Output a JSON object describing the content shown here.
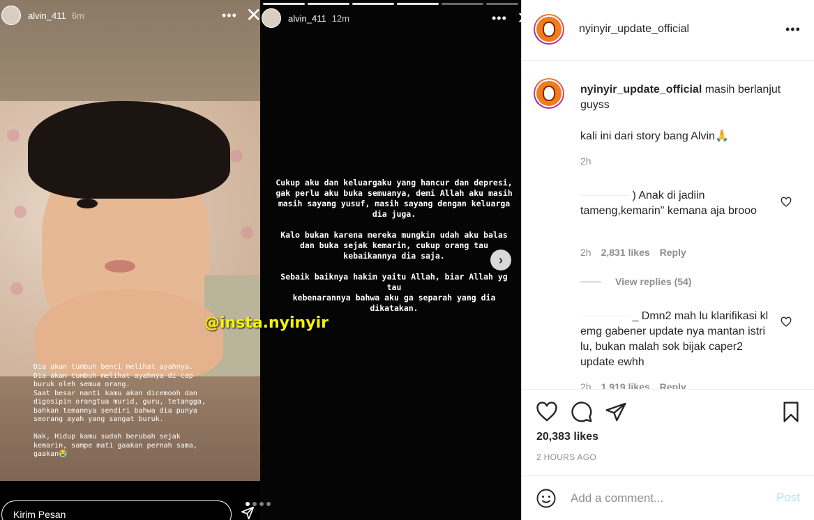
{
  "left_story": {
    "username": "alvin_411",
    "time": "6m",
    "more": "•••",
    "close": "✕",
    "watermark": "@insta.nyinyir",
    "caption": "Dia akan tumbuh benci melihat ayahnya.\nDia akan tumbuh melihat ayahnya di cap\nburuk oleh semua orang.\nSaat besar nanti kamu akan dicemooh dan\ndigosipin orangtua murid, guru, tetangga,\nbahkan temannya sendiri bahwa dia punya\nseorang ayah yang sangat buruk.\n\nNak, Hidup kamu sudah berubah sejak\nkemarin, sampe mati gaakan pernah sama,\ngaakan😭",
    "send_placeholder": "Kirim Pesan"
  },
  "mid_story": {
    "username": "alvin_411",
    "time": "12m",
    "more": "•••",
    "text": "Cukup aku dan keluargaku yang hancur dan depresi,\ngak perlu aku buka semuanya, demi Allah aku masih\nmasih sayang yusuf, masih sayang dengan keluarga\ndia juga.\n\nKalo bukan karena mereka mungkin udah aku balas\ndan buka sejak kemarin, cukup orang tau\nkebaikannya dia saja.\n\nSebaik baiknya hakim yaitu Allah, biar Allah yg tau\nkebenarannya bahwa aku ga separah yang dia\ndikatakan.",
    "next": "›"
  },
  "post": {
    "username": "nyinyir_update_official",
    "more": "•••",
    "caption_user": "nyinyir_update_official",
    "caption_text": " masih berlanjut guyss",
    "caption_extra": "kali ini dari story bang Alvin🙏",
    "caption_time": "2h",
    "comments": [
      {
        "text": ") Anak di jadiin tameng,kemarin\" kemana aja brooo",
        "time": "2h",
        "likes": "2,831 likes",
        "reply": "Reply",
        "view_replies": "View replies (54)"
      },
      {
        "text": "_ Dmn2 mah lu klarifikasi kl emg gabener update nya mantan istri lu, bukan malah sok bijak caper2 update ewhh",
        "time": "2h",
        "likes": "1,919 likes",
        "reply": "Reply"
      }
    ],
    "likes": "20,383 likes",
    "ago": "2 HOURS AGO",
    "add_comment_placeholder": "Add a comment...",
    "post_button": "Post"
  },
  "icons": {
    "heart": "heart-icon",
    "comment": "comment-icon",
    "share": "share-icon",
    "bookmark": "bookmark-icon",
    "emoji": "emoji-icon",
    "send": "send-icon"
  },
  "colors": {
    "watermark": "#f5f500",
    "post_disabled": "#b2dffc",
    "muted": "#8e8e8e",
    "text": "#262626"
  }
}
